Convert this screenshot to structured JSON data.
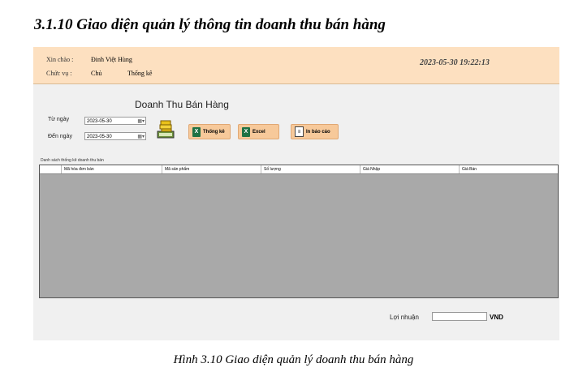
{
  "heading": "3.1.10 Giao diện quản lý thông tin doanh thu bán hàng",
  "header": {
    "greeting_label": "Xin chào :",
    "greeting_value": "Đinh Việt Hùng",
    "role_label": "Chức vụ :",
    "role_value": "Chủ",
    "menu_item": "Thống kê",
    "clock": "2023-05-30 19:22:13"
  },
  "form": {
    "title": "Doanh Thu Bán Hàng",
    "from_label": "Từ ngày",
    "from_value": "2023-05-30",
    "to_label": "Đến ngày",
    "to_value": "2023-05-30",
    "btn_stats": "Thống kê",
    "btn_excel": "Excel",
    "btn_report": "In báo cáo",
    "excel_glyph": "X"
  },
  "grid": {
    "label": "Danh sách thống kê doanh thu bán",
    "columns": [
      "Mã hóa đơn bán",
      "Mã sản phẩm",
      "Số lượng",
      "Giá Nhập",
      "Giá Bán"
    ]
  },
  "footer": {
    "profit_label": "Lợi nhuận",
    "currency": "VND"
  },
  "caption": "Hình 3.10 Giao diện quản lý doanh thu bán hàng",
  "colors": {
    "header_bg": "#fde0c0",
    "button_bg": "#f7c99a",
    "grid_bg": "#a9a9a9"
  }
}
